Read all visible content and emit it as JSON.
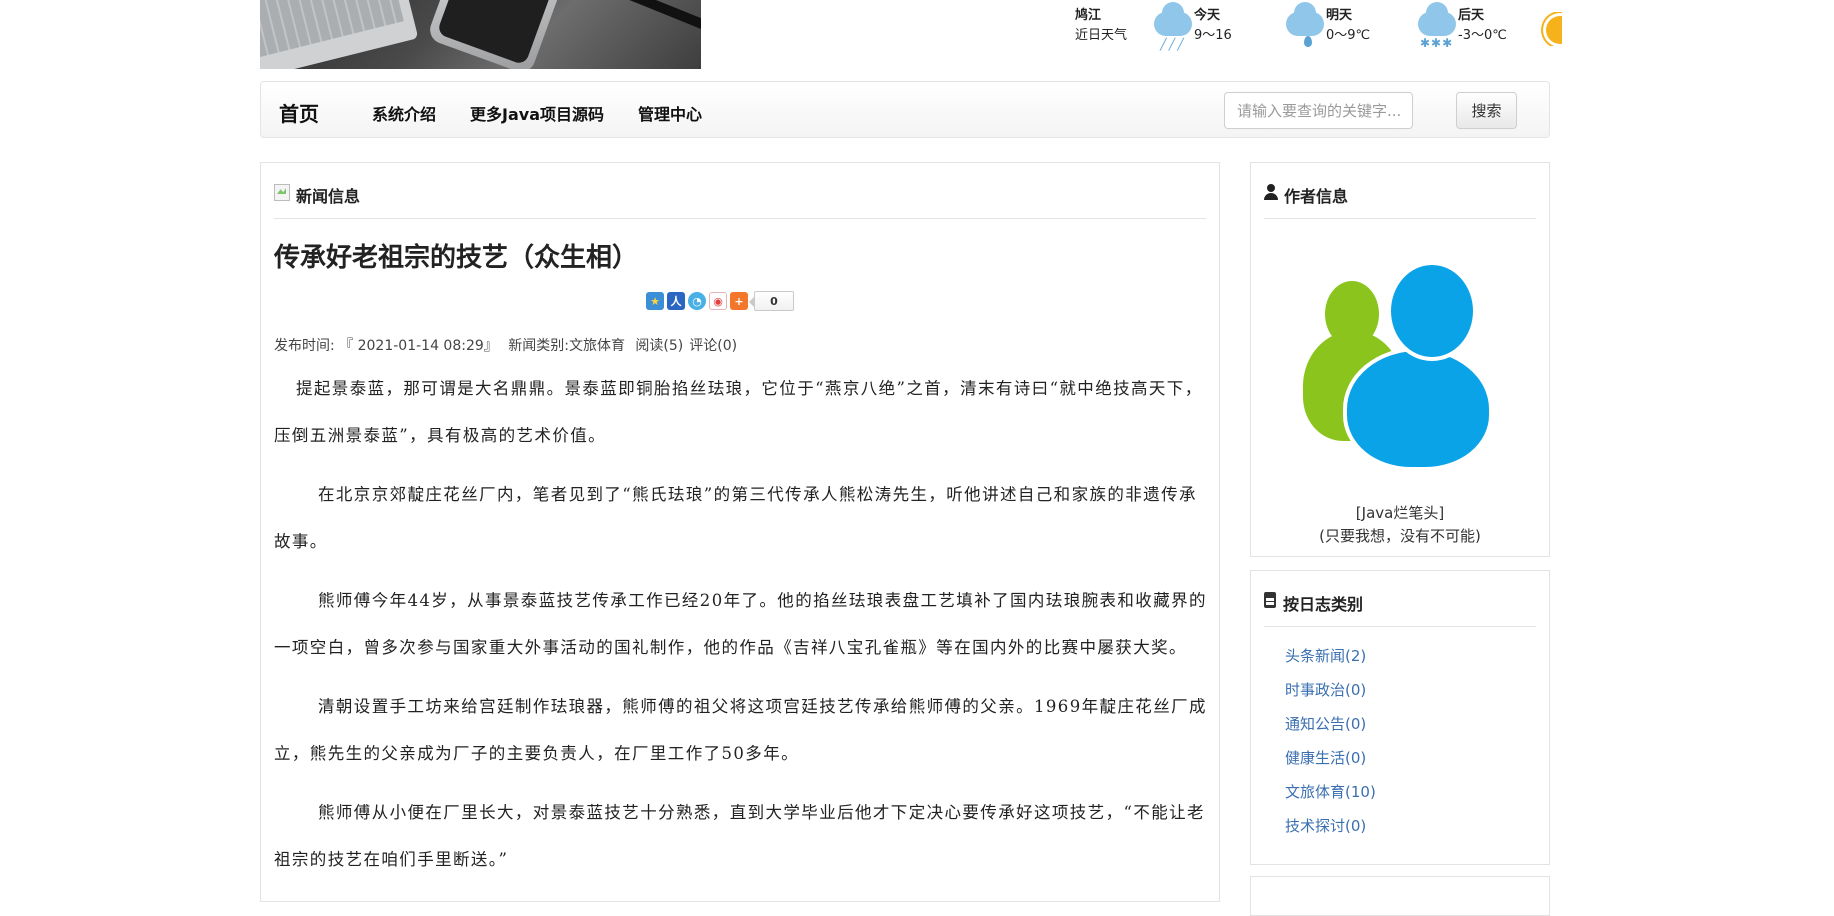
{
  "weather": {
    "city": "鸠江",
    "subtitle": "近日天气",
    "days": [
      {
        "label": "今天",
        "temp": "9～16",
        "icon": "rain-cloud-icon"
      },
      {
        "label": "明天",
        "temp": "0～9℃",
        "icon": "drizzle-cloud-icon"
      },
      {
        "label": "后天",
        "temp": "-3～0℃",
        "icon": "snow-cloud-icon"
      }
    ],
    "colors": {
      "cloud": "#8fc6ea",
      "rain": "#5aa2d4",
      "sun": "#f6b21a"
    }
  },
  "nav": {
    "brand": "首页",
    "links": [
      "系统介绍",
      "更多Java项目源码",
      "管理中心"
    ],
    "search_placeholder": "请输入要查询的关键字...",
    "search_button": "搜索"
  },
  "article_panel": {
    "heading": "新闻信息",
    "title": "传承好老祖宗的技艺（众生相）",
    "share_count": "0",
    "meta": {
      "publish": "发布时间: 『 2021-01-14 08:29』",
      "category": "新闻类别:文旅体育",
      "reads": "阅读(5)",
      "comments": "评论(0)"
    },
    "paragraphs": [
      "提起景泰蓝，那可谓是大名鼎鼎。景泰蓝即铜胎掐丝珐琅，它位于“燕京八绝”之首，清末有诗曰“就中绝技高天下，压倒五洲景泰蓝”，具有极高的艺术价值。",
      "在北京京郊靛庄花丝厂内，笔者见到了“熊氏珐琅”的第三代传承人熊松涛先生，听他讲述自己和家族的非遗传承故事。",
      "熊师傅今年44岁，从事景泰蓝技艺传承工作已经20年了。他的掐丝珐琅表盘工艺填补了国内珐琅腕表和收藏界的一项空白，曾多次参与国家重大外事活动的国礼制作，他的作品《吉祥八宝孔雀瓶》等在国内外的比赛中屡获大奖。",
      "清朝设置手工坊来给宫廷制作珐琅器，熊师傅的祖父将这项宫廷技艺传承给熊师傅的父亲。1969年靛庄花丝厂成立，熊先生的父亲成为厂子的主要负责人，在厂里工作了50多年。",
      "熊师傅从小便在厂里长大，对景泰蓝技艺十分熟悉，直到大学毕业后他才下定决心要传承好这项技艺，“不能让老祖宗的技艺在咱们手里断送。”"
    ]
  },
  "author_panel": {
    "heading": "作者信息",
    "name": "[Java烂笔头]",
    "motto": "(只要我想，没有不可能)"
  },
  "category_panel": {
    "heading": "按日志类别",
    "items": [
      {
        "label": "头条新闻(2)"
      },
      {
        "label": "时事政治(0)"
      },
      {
        "label": "通知公告(0)"
      },
      {
        "label": "健康生活(0)"
      },
      {
        "label": "文旅体育(10)"
      },
      {
        "label": "技术探讨(0)"
      }
    ],
    "link_color": "#3a6fb0"
  }
}
